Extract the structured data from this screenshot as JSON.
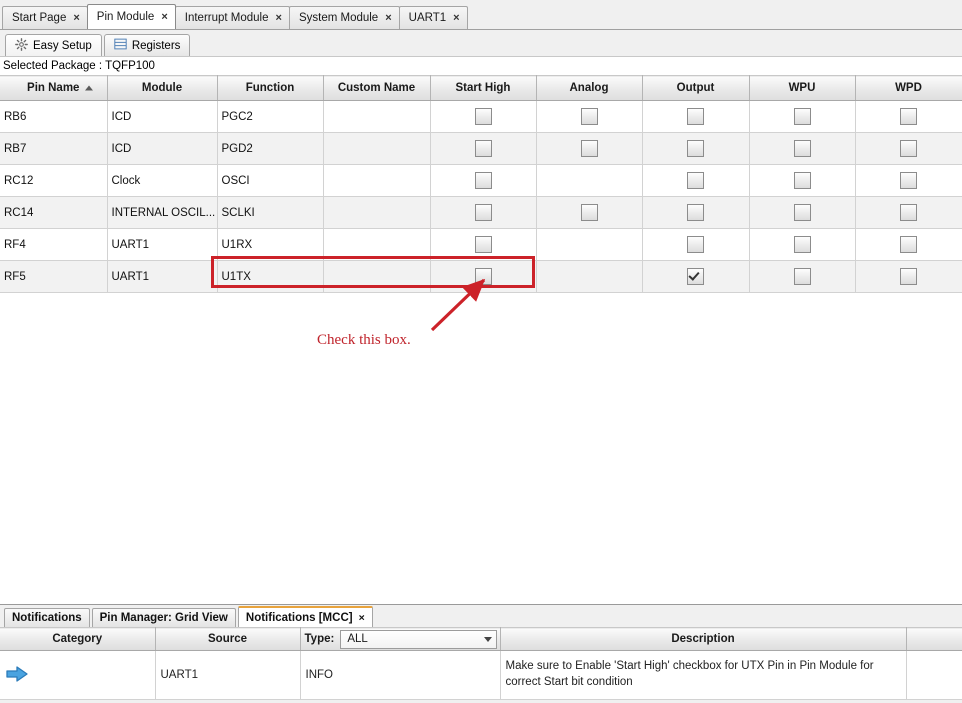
{
  "window": {
    "tabs": [
      {
        "label": "Start Page",
        "active": false,
        "close": "×"
      },
      {
        "label": "Pin Module",
        "active": true,
        "close": "×"
      },
      {
        "label": "Interrupt Module",
        "active": false,
        "close": "×"
      },
      {
        "label": "System Module",
        "active": false,
        "close": "×"
      },
      {
        "label": "UART1",
        "active": false,
        "close": "×"
      }
    ]
  },
  "subtabs": [
    {
      "label": "Easy Setup",
      "icon": "gear-icon",
      "active": true
    },
    {
      "label": "Registers",
      "icon": "registers-icon",
      "active": false
    }
  ],
  "package": {
    "text": "Selected Package : TQFP100"
  },
  "pin_grid": {
    "columns": [
      {
        "label": "Pin Name",
        "sorted": true
      },
      {
        "label": "Module",
        "sorted": false
      },
      {
        "label": "Function",
        "sorted": false
      },
      {
        "label": "Custom Name",
        "sorted": false
      },
      {
        "label": "Start High",
        "sorted": false
      },
      {
        "label": "Analog",
        "sorted": false
      },
      {
        "label": "Output",
        "sorted": false
      },
      {
        "label": "WPU",
        "sorted": false
      },
      {
        "label": "WPD",
        "sorted": false
      }
    ],
    "rows": [
      {
        "pin": "RB6",
        "module": "ICD",
        "function": "PGC2",
        "custom": "",
        "start_high": {
          "present": true,
          "checked": false
        },
        "analog": {
          "present": true,
          "checked": false
        },
        "output": {
          "present": true,
          "checked": false
        },
        "wpu": {
          "present": true,
          "checked": false
        },
        "wpd": {
          "present": true,
          "checked": false
        }
      },
      {
        "pin": "RB7",
        "module": "ICD",
        "function": "PGD2",
        "custom": "",
        "start_high": {
          "present": true,
          "checked": false
        },
        "analog": {
          "present": true,
          "checked": false
        },
        "output": {
          "present": true,
          "checked": false
        },
        "wpu": {
          "present": true,
          "checked": false
        },
        "wpd": {
          "present": true,
          "checked": false
        }
      },
      {
        "pin": "RC12",
        "module": "Clock",
        "function": "OSCI",
        "custom": "",
        "start_high": {
          "present": true,
          "checked": false
        },
        "analog": {
          "present": false,
          "checked": false
        },
        "output": {
          "present": true,
          "checked": false
        },
        "wpu": {
          "present": true,
          "checked": false
        },
        "wpd": {
          "present": true,
          "checked": false
        }
      },
      {
        "pin": "RC14",
        "module": "INTERNAL OSCIL...",
        "function": "SCLKI",
        "custom": "",
        "start_high": {
          "present": true,
          "checked": false
        },
        "analog": {
          "present": true,
          "checked": false
        },
        "output": {
          "present": true,
          "checked": false
        },
        "wpu": {
          "present": true,
          "checked": false
        },
        "wpd": {
          "present": true,
          "checked": false
        }
      },
      {
        "pin": "RF4",
        "module": "UART1",
        "function": "U1RX",
        "custom": "",
        "start_high": {
          "present": true,
          "checked": false
        },
        "analog": {
          "present": false,
          "checked": false
        },
        "output": {
          "present": true,
          "checked": false
        },
        "wpu": {
          "present": true,
          "checked": false
        },
        "wpd": {
          "present": true,
          "checked": false
        }
      },
      {
        "pin": "RF5",
        "module": "UART1",
        "function": "U1TX",
        "custom": "",
        "start_high": {
          "present": true,
          "checked": false
        },
        "analog": {
          "present": false,
          "checked": false
        },
        "output": {
          "present": true,
          "checked": true
        },
        "wpu": {
          "present": true,
          "checked": false
        },
        "wpd": {
          "present": true,
          "checked": false
        }
      }
    ]
  },
  "annotation": {
    "text": "Check this box.",
    "color": "#c0242c"
  },
  "bottom_panel": {
    "tabs": [
      {
        "label": "Notifications",
        "active": false,
        "close": ""
      },
      {
        "label": "Pin Manager: Grid View",
        "active": false,
        "close": ""
      },
      {
        "label": "Notifications [MCC]",
        "active": true,
        "close": "×"
      }
    ],
    "columns": [
      {
        "label": "Category"
      },
      {
        "label": "Source"
      },
      {
        "label": "Type:"
      },
      {
        "label": "Description"
      },
      {
        "label": ""
      }
    ],
    "type_filter": {
      "label": "Type:",
      "value": "ALL",
      "chevron": "chevron-down-icon"
    },
    "rows": [
      {
        "category_icon": "blue-right-arrow-icon",
        "source": "UART1",
        "type": "INFO",
        "description": "Make sure to Enable 'Start High' checkbox for UTX Pin in Pin Module for correct Start bit condition"
      }
    ]
  }
}
